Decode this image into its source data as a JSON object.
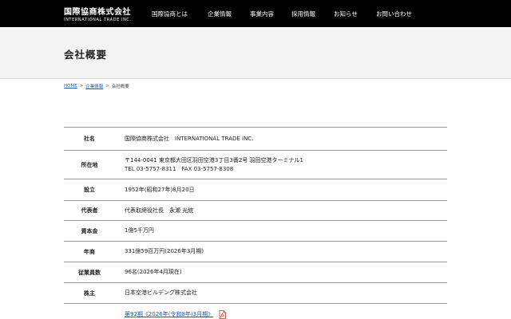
{
  "header": {
    "logo_jp": "国際協商株式会社",
    "logo_en": "INTERNATIONAL TRADE INC.",
    "nav": [
      "国際協商とは",
      "企業情報",
      "事業内容",
      "採用情報",
      "お知らせ",
      "お問い合わせ"
    ]
  },
  "page_title": "会社概要",
  "breadcrumb": {
    "home": "HOME",
    "sep": ">",
    "parent": "企業情報",
    "current": "会社概要"
  },
  "table": [
    {
      "label": "社名",
      "lines": [
        "国際協商株式会社　INTERNATIONAL TRADE INC."
      ]
    },
    {
      "label": "所在地",
      "lines": [
        "〒144-0041 東京都大田区羽田空港3丁目3番2号 羽田空港ターミナル1",
        "TEL 03-5757-8311　FAX 03-5757-8308"
      ]
    },
    {
      "label": "設立",
      "lines": [
        "1952年(昭和27年)8月20日"
      ]
    },
    {
      "label": "代表者",
      "lines": [
        "代表取締役社長　永瀬 光統"
      ]
    },
    {
      "label": "資本金",
      "lines": [
        "1億5千万円"
      ]
    },
    {
      "label": "年商",
      "lines": [
        "331億59百万円(2026年3月期)"
      ]
    },
    {
      "label": "従業員数",
      "lines": [
        "96名(2026年4月現在)"
      ]
    },
    {
      "label": "株主",
      "lines": [
        "日本空港ビルデング株式会社"
      ]
    }
  ],
  "report_link": "第92期《2026年(令和8年)3月期》",
  "icons": {
    "pdf": "pdf-icon"
  },
  "colors": {
    "header_bg": "#000000",
    "link": "#1a5bb5",
    "pdf_red": "#d9261c"
  }
}
